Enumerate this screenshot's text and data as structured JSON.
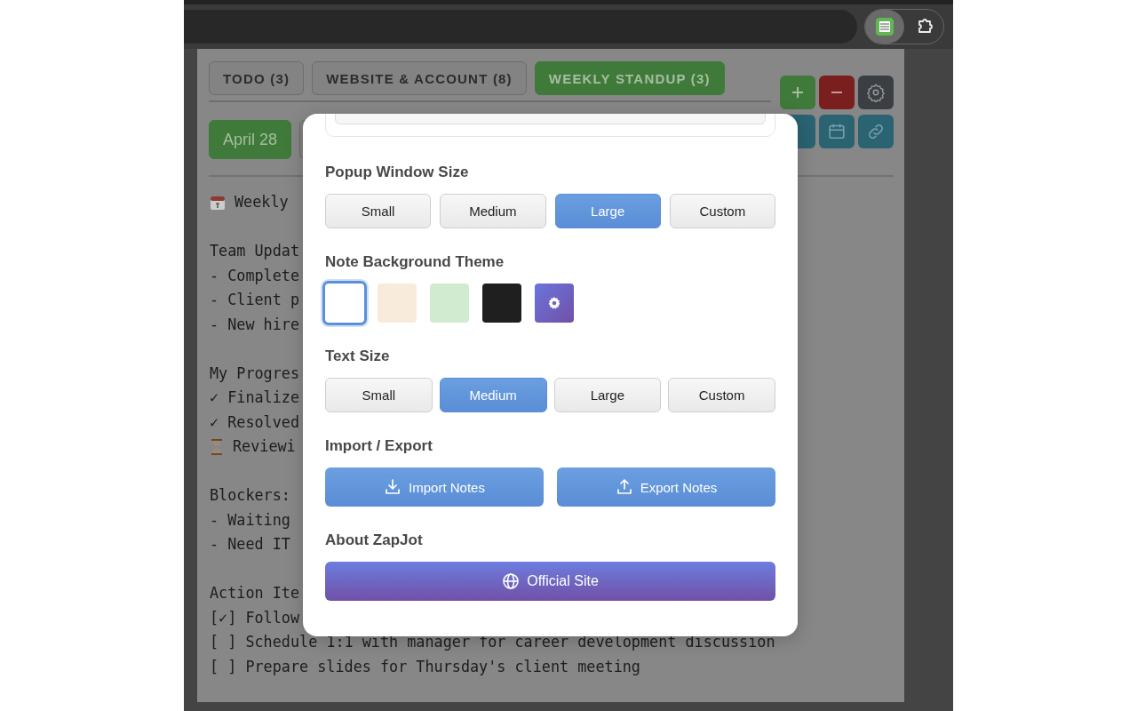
{
  "tabs": [
    {
      "label": "TODO (3)",
      "selected": false
    },
    {
      "label": "WEBSITE & ACCOUNT (8)",
      "selected": false
    },
    {
      "label": "WEEKLY STANDUP (3)",
      "selected": true
    }
  ],
  "dates": [
    {
      "label": "April 28",
      "selected": true
    }
  ],
  "note": {
    "blocks": [
      [
        {
          "kind": "calendar",
          "text": "Weekly"
        }
      ],
      [
        {
          "text": "Team Updat"
        },
        {
          "text": "- Complete"
        },
        {
          "text": "- Client p"
        },
        {
          "text": "- New hire"
        }
      ],
      [
        {
          "text": "My Progres"
        },
        {
          "text": "✓ Finalize"
        },
        {
          "text": "✓ Resolved"
        },
        {
          "kind": "hourglass",
          "text": "Reviewi"
        }
      ],
      [
        {
          "text": "Blockers:"
        },
        {
          "text": "- Waiting"
        },
        {
          "text": "- Need IT"
        }
      ],
      [
        {
          "text": "Action Ite"
        },
        {
          "text": "[✓] Follow"
        },
        {
          "text": "[ ] Schedule 1:1 with manager for career development discussion"
        },
        {
          "text": "[ ] Prepare slides for Thursday's client meeting"
        }
      ]
    ]
  },
  "settings": {
    "sections": [
      {
        "kind": "options",
        "title": "Popup Window Size",
        "options": [
          {
            "label": "Small",
            "selected": false
          },
          {
            "label": "Medium",
            "selected": false
          },
          {
            "label": "Large",
            "selected": true
          },
          {
            "label": "Custom",
            "selected": false
          }
        ]
      },
      {
        "kind": "themes",
        "title": "Note Background Theme",
        "swatches": [
          {
            "kind": "color",
            "color": "#ffffff",
            "selected": true
          },
          {
            "kind": "color",
            "color": "#f9ebdc",
            "selected": false
          },
          {
            "kind": "color",
            "color": "#d0ebd0",
            "selected": false
          },
          {
            "kind": "color",
            "color": "#1f1f1f",
            "selected": false
          },
          {
            "kind": "custom",
            "selected": false
          }
        ]
      },
      {
        "kind": "options",
        "title": "Text Size",
        "options": [
          {
            "label": "Small",
            "selected": false
          },
          {
            "label": "Medium",
            "selected": true
          },
          {
            "label": "Large",
            "selected": false
          },
          {
            "label": "Custom",
            "selected": false
          }
        ]
      },
      {
        "kind": "actions",
        "title": "Import / Export",
        "actions": [
          {
            "kind": "import",
            "label": "Import Notes"
          },
          {
            "kind": "export",
            "label": "Export Notes"
          }
        ]
      },
      {
        "kind": "link",
        "title": "About ZapJot",
        "label": "Official Site"
      }
    ]
  }
}
